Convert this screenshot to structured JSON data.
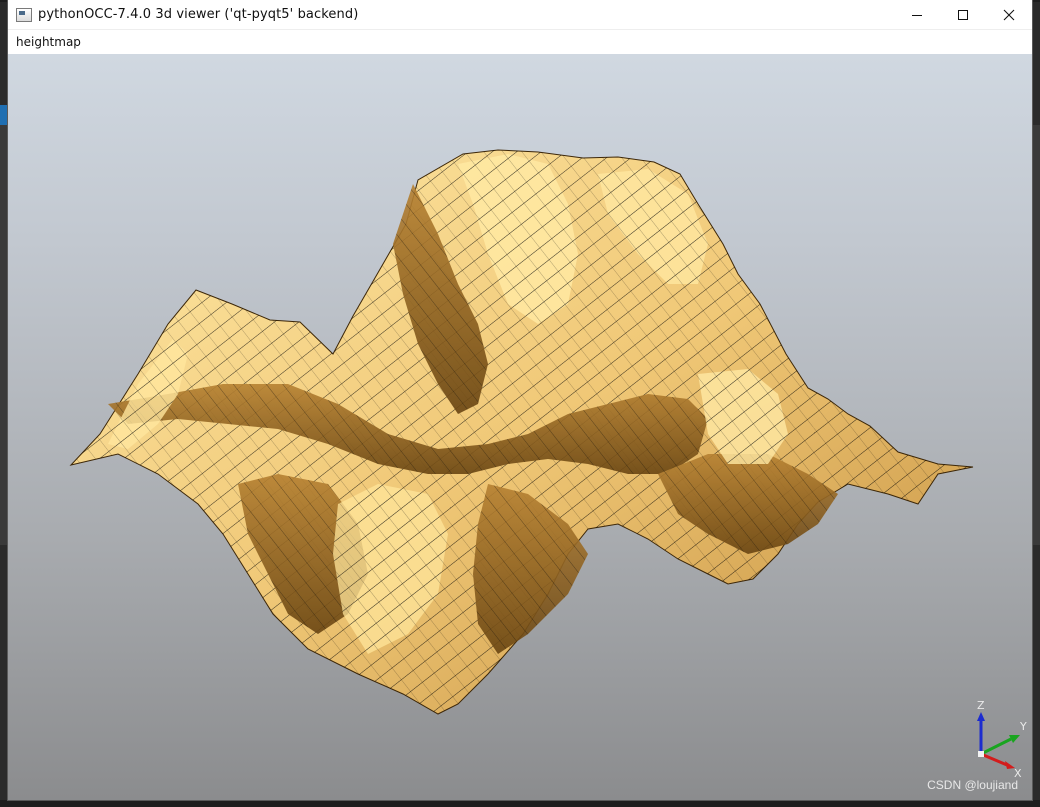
{
  "window": {
    "title": "pythonOCC-7.4.0 3d viewer ('qt-pyqt5' backend)"
  },
  "menubar": {
    "items": [
      {
        "label": "heightmap"
      }
    ]
  },
  "viewport": {
    "content": "heightmap surface",
    "surface_color": "#e8b867",
    "edge_color": "#000000",
    "background_top": "#d0d8e1",
    "background_bottom": "#8b8c8e"
  },
  "triedron": {
    "z_label": "Z",
    "y_label": "Y",
    "x_label": "X",
    "z_color": "#1c2ccf",
    "y_color": "#19a51f",
    "x_color": "#d31c1c"
  },
  "watermark": {
    "text": "CSDN @loujiand"
  },
  "icons": {
    "app": "app-window-icon",
    "minimize": "minimize-icon",
    "maximize": "maximize-icon",
    "close": "close-icon"
  }
}
